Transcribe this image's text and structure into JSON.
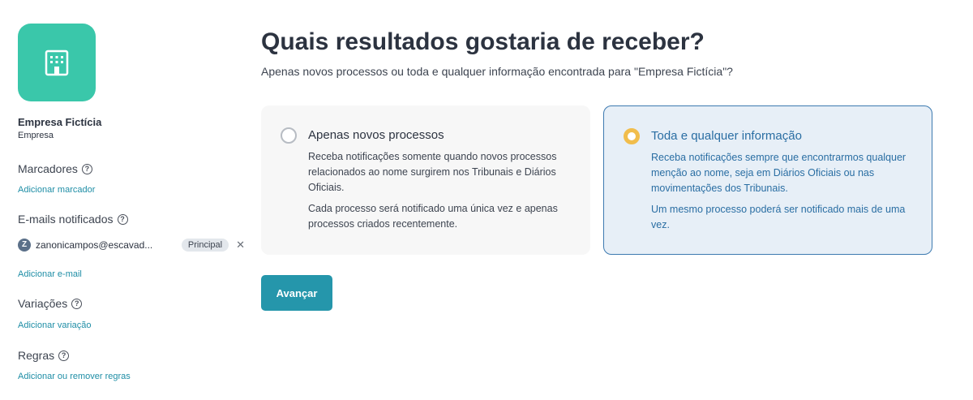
{
  "sidebar": {
    "logo_icon": "building-icon",
    "entity_name": "Empresa Fictícia",
    "entity_type": "Empresa",
    "marcadores": {
      "label": "Marcadores",
      "link": "Adicionar marcador"
    },
    "emails": {
      "label": "E-mails notificados",
      "items": [
        {
          "avatar": "Z",
          "address": "zanonicampos@escavad...",
          "badge": "Principal"
        }
      ],
      "link": "Adicionar e-mail"
    },
    "variacoes": {
      "label": "Variações",
      "link": "Adicionar variação"
    },
    "regras": {
      "label": "Regras",
      "link": "Adicionar ou remover regras"
    }
  },
  "main": {
    "title": "Quais resultados gostaria de receber?",
    "subtitle": "Apenas novos processos ou toda e qualquer informação encontrada para \"Empresa Fictícia\"?",
    "options": [
      {
        "title": "Apenas novos processos",
        "text1": "Receba notificações somente quando novos processos relacionados ao nome surgirem nos Tribunais e Diários Oficiais.",
        "text2": "Cada processo será notificado uma única vez e apenas processos criados recentemente.",
        "selected": false
      },
      {
        "title": "Toda e qualquer informação",
        "text1": "Receba notificações sempre que encontrarmos qualquer menção ao nome, seja em Diários Oficiais ou nas movimentações dos Tribunais.",
        "text2": "Um mesmo processo poderá ser notificado mais de uma vez.",
        "selected": true
      }
    ],
    "button": "Avançar"
  },
  "colors": {
    "logo": "#3ac7aa",
    "link": "#1f8ea6",
    "selected_border": "#3d7ab0",
    "radio_selected": "#f1bd4c",
    "button": "#2596ab"
  }
}
